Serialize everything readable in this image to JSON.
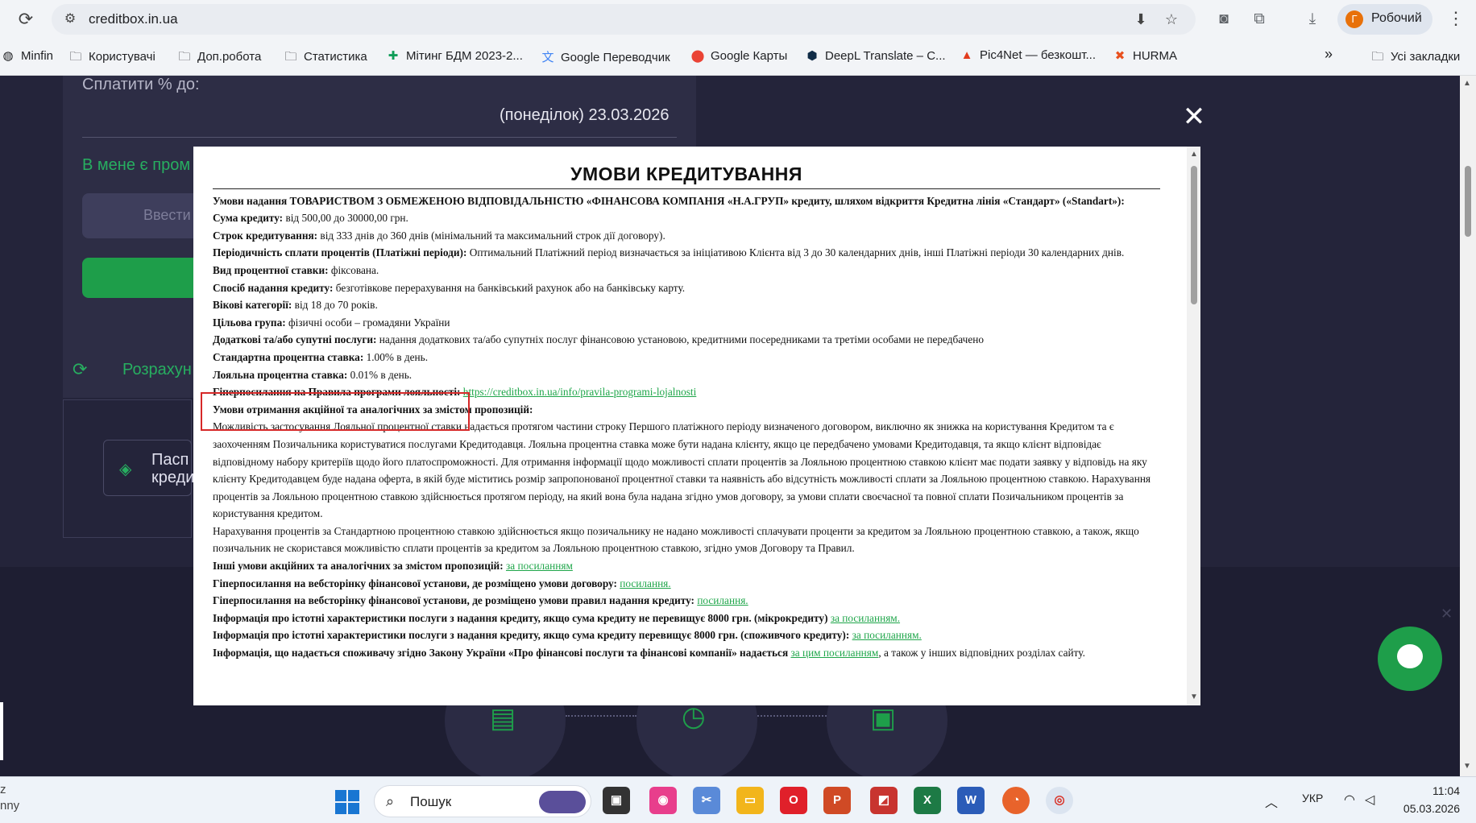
{
  "browser": {
    "url": "creditbox.in.ua",
    "profile_initial": "Г",
    "profile_name": "Робочий",
    "bookmarks": [
      {
        "label": "Minfin",
        "icon": "globe-icon"
      },
      {
        "label": "Користувачі",
        "icon": "folder-icon"
      },
      {
        "label": "Доп.робота",
        "icon": "folder-icon"
      },
      {
        "label": "Статистика",
        "icon": "folder-icon"
      },
      {
        "label": "Мітинг БДМ 2023-2...",
        "icon": "plus-icon"
      },
      {
        "label": "Google Переводчик",
        "icon": "translate-icon"
      },
      {
        "label": "Google Карты",
        "icon": "map-pin-icon"
      },
      {
        "label": "DeepL Translate – С...",
        "icon": "deepl-icon"
      },
      {
        "label": "Pic4Net — безкошт...",
        "icon": "flame-icon"
      },
      {
        "label": "HURMA",
        "icon": "hurma-icon"
      }
    ],
    "all_bookmarks": "Усі закладки",
    "more_bookmarks": "»"
  },
  "site": {
    "pay_label": "Сплатити % до:",
    "pay_date": "(понеділок) 23.03.2026",
    "promo_question": "В мене є пром",
    "promo_placeholder": "Ввести",
    "calc_text": "Розрахун",
    "passport_text_1": "Пасп",
    "passport_text_2": "креди",
    "close_symbol": "✕",
    "chat_x": "✕"
  },
  "modal": {
    "title": "УМОВИ КРЕДИТУВАННЯ",
    "intro": "Умови надання ТОВАРИСТВОМ З ОБМЕЖЕНОЮ ВІДПОВІДАЛЬНІСТЮ «ФІНАНСОВА КОМПАНІЯ «Н.А.ГРУП» кредиту, шляхом відкриття Кредитна лінія «Стандарт» («Standart»):",
    "rows": [
      {
        "label": "Сума кредиту:",
        "value": " від 500,00 до 30000,00 грн."
      },
      {
        "label": "Строк кредитування:",
        "value": " від 333 днів до 360 днів (мінімальний та максимальний строк дії договору)."
      },
      {
        "label": "Періодичність сплати процентів (Платіжні періоди):",
        "value": " Оптимальний Платіжний період визначається за ініціативою Клієнта від 3 до 30 календарних днів, інші Платіжні періоди 30 календарних днів."
      },
      {
        "label": "Вид процентної ставки:",
        "value": " фіксована."
      },
      {
        "label": "Спосіб надання кредиту:",
        "value": " безготівкове перерахування на банківський рахунок або на банківську карту."
      },
      {
        "label": "Вікові категорії:",
        "value": " від 18 до 70 років."
      },
      {
        "label": "Цільова група:",
        "value": " фізичні особи – громадяни України"
      },
      {
        "label": "Додаткові та/або супутні послуги:",
        "value": " надання додаткових та/або супутніх послуг фінансовою установою, кредитними посередниками та третіми особами не передбачено"
      },
      {
        "label": "Стандартна процентна ставка:",
        "value": " 1.00% в день."
      },
      {
        "label": "Лояльна процентна ставка:",
        "value": " 0.01% в день."
      }
    ],
    "loyalty_label": "Гіперпосилання на Правила програми лояльності:",
    "loyalty_link": "https://creditbox.in.ua/info/pravila-programi-lojalnosti",
    "promo_heading": "Умови отримання акційної та аналогічних за змістом пропозицій:",
    "promo_para_1": "Можливість застосування Лояльної процентної ставки надається протягом частини строку Першого платіжного періоду визначеного договором, виключно як знижка на користування Кредитом та є заохоченням Позичальника користуватися послугами Кредитодавця. Лояльна процентна ставка може бути надана клієнту, якщо це передбачено умовами Кредитодавця, та якщо клієнт відповідає відповідному набору критеріїв щодо його платоспроможності. Для отримання інформації щодо можливості сплати процентів за Лояльною процентною ставкою клієнт має подати заявку у відповідь на яку клієнту Кредитодавцем буде надана оферта, в якій буде міститись розмір запропонованої процентної ставки та наявність або відсутність можливості сплати за Лояльною процентною ставкою. Нарахування процентів за Лояльною процентною ставкою здійснюється протягом періоду, на який вона була надана згідно умов договору, за умови сплати своєчасної та повної сплати Позичальником процентів за користування кредитом.",
    "promo_para_2": "Нарахування процентів за Стандартною процентною ставкою здійснюється якщо позичальнику не надано можливості сплачувати проценти за кредитом за Лояльною процентною ставкою, а також, якщо позичальник не скористався можливістю сплати процентів за кредитом за Лояльною процентною ставкою, згідно умов Договору та Правил.",
    "links": [
      {
        "label": "Інші умови акційних та аналогічних за змістом пропозицій:",
        "link": "за посиланням"
      },
      {
        "label": "Гіперпосилання на вебсторінку фінансової установи, де розміщено умови договору:",
        "link": "посилання."
      },
      {
        "label": "Гіперпосилання на вебсторінку фінансової установи, де розміщено умови правил надання кредиту:",
        "link": "посилання."
      },
      {
        "label": "Інформація про істотні характеристики послуги з надання кредиту, якщо сума кредиту не перевищує 8000 грн. (мікрокредиту)",
        "link": "за посиланням."
      },
      {
        "label": "Інформація про істотні характеристики послуги з надання кредиту, якщо сума кредиту перевищує 8000 грн. (споживчого кредиту):",
        "link": "за посиланням."
      }
    ],
    "last_label": "Інформація, що надається споживачу згідно Закону України «Про фінансові послуги та фінансові компанії» надається",
    "last_link": "за цим посиланням",
    "last_tail": ", а також у інших відповідних розділах сайту."
  },
  "taskbar": {
    "left_text_1": "z",
    "left_text_2": "nny",
    "search_placeholder": "Пошук",
    "lang": "УКР",
    "time": "11:04",
    "date": "05.03.2026"
  },
  "colors": {
    "site_bg": "#24243a",
    "accent_green": "#1e9e4a",
    "link_green": "#1fa64a",
    "highlight_red": "#d62828"
  }
}
